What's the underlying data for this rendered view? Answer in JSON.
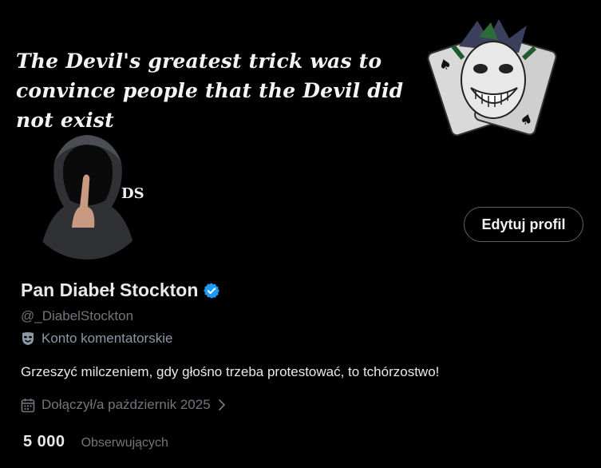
{
  "banner": {
    "quote": "The Devil's greatest trick was to convince people that the Devil did not exist",
    "image_icon": "joker-cards-illustration"
  },
  "avatar": {
    "icon": "hooded-figure-avatar",
    "monogram": "DS"
  },
  "actions": {
    "edit_profile_label": "Edytuj profil"
  },
  "profile": {
    "display_name": "Pan Diabeł Stockton",
    "verified": true,
    "handle": "@_DiabelStockton",
    "account_label": "Konto komentatorskie",
    "bio": "Grzeszyć milczeniem, gdy głośno trzeba protestować, to tchórzostwo!",
    "joined": "Dołączył/a październik 2025"
  },
  "stats": {
    "followers_count": "5 000",
    "followers_label": "Obserwujących"
  },
  "colors": {
    "background": "#000000",
    "text_primary": "#e7e9ea",
    "text_secondary": "#71767b",
    "verified_blue": "#1d9bf0",
    "button_border": "#536471"
  }
}
